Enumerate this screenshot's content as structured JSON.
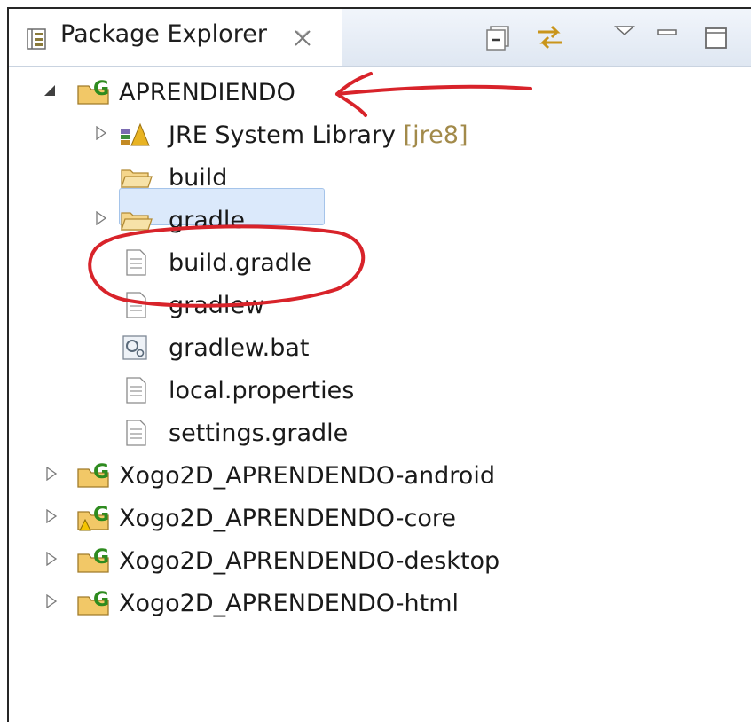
{
  "tab": {
    "title": "Package Explorer",
    "icon": "package-explorer-icon",
    "close_icon": "close-icon"
  },
  "toolbar": {
    "buttons": [
      "collapse-all-icon",
      "link-with-editor-icon",
      "view-menu-icon",
      "minimize-icon",
      "maximize-icon"
    ]
  },
  "tree": {
    "project": {
      "name": "APRENDIENDO",
      "icon": "gradle-project-icon",
      "expanded": true
    },
    "children": [
      {
        "label": "JRE System Library",
        "decoration": "[jre8]",
        "icon": "library-icon",
        "expandable": true
      },
      {
        "label": "build",
        "icon": "folder-icon",
        "expandable": false
      },
      {
        "label": "gradle",
        "icon": "folder-icon",
        "expandable": true
      },
      {
        "label": "build.gradle",
        "icon": "file-icon",
        "selected": true
      },
      {
        "label": "gradlew",
        "icon": "file-icon"
      },
      {
        "label": "gradlew.bat",
        "icon": "batch-file-icon"
      },
      {
        "label": "local.properties",
        "icon": "file-icon"
      },
      {
        "label": "settings.gradle",
        "icon": "file-icon"
      }
    ],
    "other_projects": [
      {
        "name": "Xogo2D_APRENDENDO-android",
        "icon": "gradle-project-icon",
        "warning": false
      },
      {
        "name": "Xogo2D_APRENDENDO-core",
        "icon": "gradle-project-icon",
        "warning": true
      },
      {
        "name": "Xogo2D_APRENDENDO-desktop",
        "icon": "gradle-project-icon",
        "warning": false
      },
      {
        "name": "Xogo2D_APRENDENDO-html",
        "icon": "gradle-project-icon",
        "warning": false
      }
    ]
  },
  "colors": {
    "annotation": "#d8232a",
    "selection": "#dbe9fb",
    "folder": "#f0c36a",
    "gradle_green": "#2e8b1f"
  }
}
